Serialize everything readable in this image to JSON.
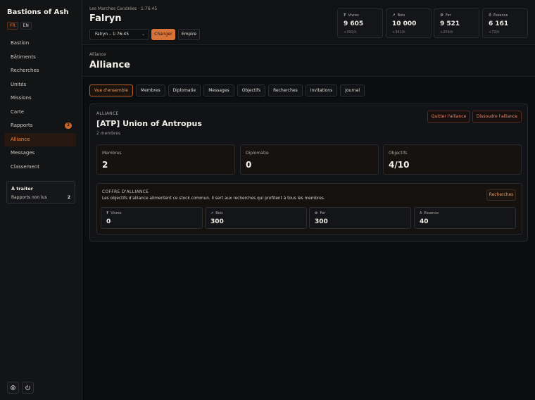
{
  "app": {
    "brand": "Bastions of Ash",
    "lang_options": [
      "FR",
      "EN"
    ]
  },
  "sidebar": {
    "items": [
      {
        "label": "Bastion"
      },
      {
        "label": "Bâtiments"
      },
      {
        "label": "Recherches"
      },
      {
        "label": "Unités"
      },
      {
        "label": "Missions"
      },
      {
        "label": "Carte"
      },
      {
        "label": "Rapports",
        "badge": "2"
      },
      {
        "label": "Alliance",
        "active": true
      },
      {
        "label": "Messages"
      },
      {
        "label": "Classement"
      }
    ],
    "todo": {
      "title": "À traiter",
      "row_label": "Rapports non lus",
      "row_count": "2"
    },
    "footer_icons": [
      "settings-icon",
      "power-icon"
    ]
  },
  "header": {
    "breadcrumb": "Les Marches Cendrées · 1:76:45",
    "city": "Falryn",
    "city_select": "Falryn – 1:76:45",
    "change_button": "Changer",
    "empire_button": "Empire",
    "resources": [
      {
        "name": "Vivres",
        "icon": "wheat-icon",
        "value": "9 605",
        "rate": "+391/h"
      },
      {
        "name": "Bois",
        "icon": "wood-icon",
        "value": "10 000",
        "rate": "+361/h"
      },
      {
        "name": "Fer",
        "icon": "iron-icon",
        "value": "9 521",
        "rate": "+259/h"
      },
      {
        "name": "Essence",
        "icon": "essence-icon",
        "value": "6 161",
        "rate": "+72/h"
      }
    ]
  },
  "page": {
    "kicker": "Alliance",
    "title": "Alliance"
  },
  "tabs": [
    {
      "label": "Vue d'ensemble",
      "active": true
    },
    {
      "label": "Membres"
    },
    {
      "label": "Diplomatie"
    },
    {
      "label": "Messages"
    },
    {
      "label": "Objectifs"
    },
    {
      "label": "Recherches"
    },
    {
      "label": "Invitations"
    },
    {
      "label": "Journal"
    }
  ],
  "alliance": {
    "kicker": "ALLIANCE",
    "name": "[ATP] Union of Antropus",
    "members_line": "2 membres",
    "leave_button": "Quitter l'alliance",
    "dissolve_button": "Dissoudre l'alliance",
    "stats": [
      {
        "label": "Membres",
        "value": "2"
      },
      {
        "label": "Diplomatie",
        "value": "0"
      },
      {
        "label": "Objectifs",
        "value": "4/10"
      }
    ],
    "vault": {
      "title": "COFFRE D'ALLIANCE",
      "description": "Les objectifs d'alliance alimentent ce stock commun. Il sert aux recherches qui profitent à tous les membres.",
      "button": "Recherches",
      "resources": [
        {
          "name": "Vivres",
          "icon": "wheat-icon",
          "value": "0"
        },
        {
          "name": "Bois",
          "icon": "wood-icon",
          "value": "300"
        },
        {
          "name": "Fer",
          "icon": "iron-icon",
          "value": "300"
        },
        {
          "name": "Essence",
          "icon": "essence-icon",
          "value": "40"
        }
      ]
    }
  },
  "colors": {
    "accent": "#d8743a",
    "background": "#0c0d0f",
    "danger": "#e98a72"
  }
}
